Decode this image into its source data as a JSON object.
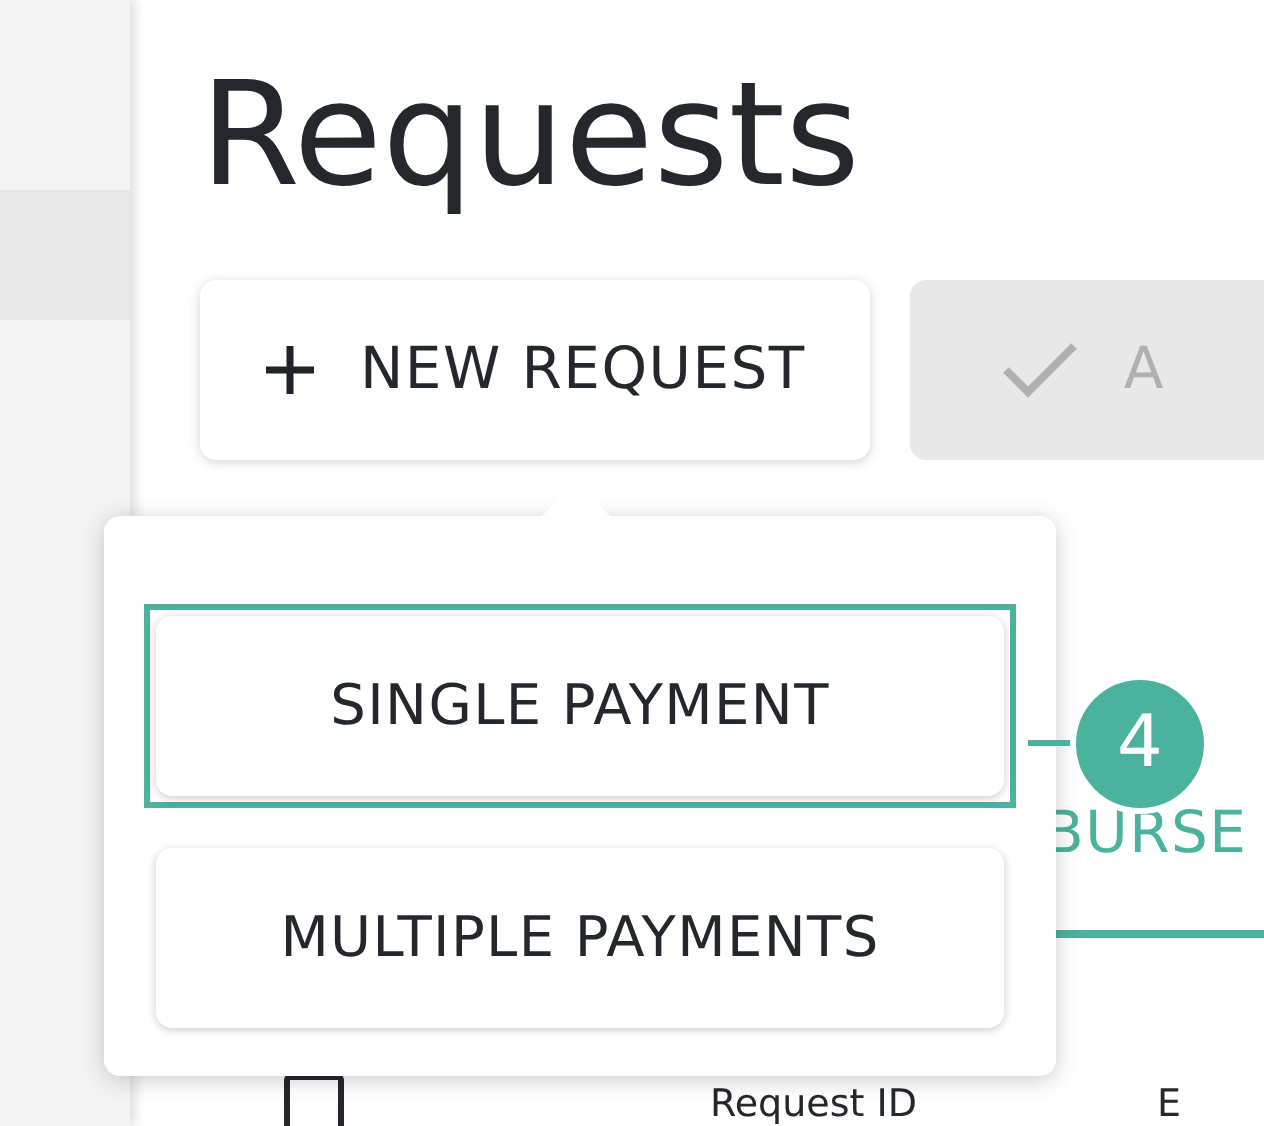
{
  "page_title": "Requests",
  "actions": [
    {
      "label": "NEW REQUEST",
      "kind": "add"
    },
    {
      "label": "A",
      "kind": "approve"
    }
  ],
  "tabs": [
    {
      "label": "BURSE",
      "selected": true
    }
  ],
  "table": {
    "select_all_checked": false,
    "columns": [
      "Request ID",
      "E"
    ]
  },
  "menu": {
    "items": [
      {
        "label": "SINGLE PAYMENT",
        "highlighted": true
      },
      {
        "label": "MULTIPLE PAYMENTS",
        "highlighted": false
      }
    ]
  },
  "callout": {
    "number": "4"
  }
}
